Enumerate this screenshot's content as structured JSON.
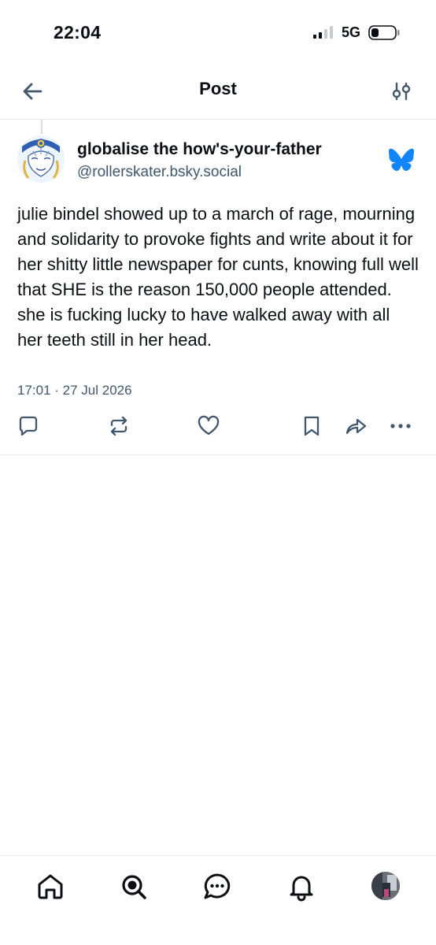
{
  "status_bar": {
    "time": "22:04",
    "network": "5G",
    "icons": [
      "signal-icon",
      "battery-icon"
    ]
  },
  "nav": {
    "title": "Post",
    "icons": [
      "back-arrow-icon",
      "sliders-icon"
    ]
  },
  "post": {
    "display_name": "globalise the how's-your-father",
    "handle": "@rollerskater.bsky.social",
    "text": "julie bindel showed up to a march of rage, mourning and solidarity to provoke fights and write about it for her shitty little newspaper for cunts, knowing full well that SHE is the reason 150,000 people attended. she is fucking lucky to have walked away with all her teeth still in her head.",
    "timestamp": "17:01 · 27 Jul 2026",
    "actions": [
      "reply-icon",
      "repost-icon",
      "like-icon",
      "bookmark-icon",
      "share-icon",
      "more-icon"
    ]
  },
  "tab_bar": {
    "tabs": [
      "home-icon",
      "search-icon",
      "chat-icon",
      "notifications-icon",
      "profile-avatar"
    ]
  },
  "colors": {
    "accent": "#1185fe",
    "icon": "#42576c",
    "text": "#0b0f14",
    "divider": "#e6eaef"
  }
}
